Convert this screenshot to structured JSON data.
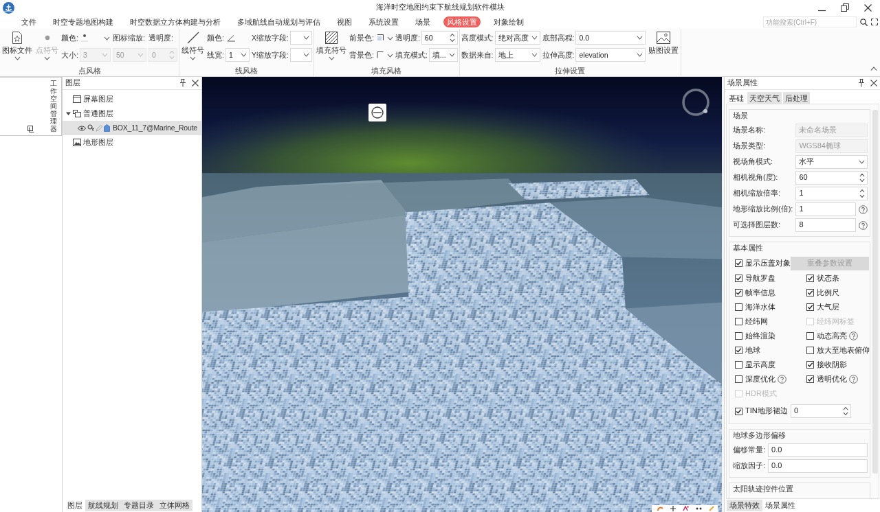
{
  "window": {
    "title": "海洋时空地图约束下航线规划软件模块"
  },
  "menu_tabs": [
    {
      "label": "文件",
      "selected": false
    },
    {
      "label": "时空专题地图构建",
      "selected": false
    },
    {
      "label": "时空数据立方体构建与分析",
      "selected": false
    },
    {
      "label": "多域航线自动规划与评估",
      "selected": false
    },
    {
      "label": "视图",
      "selected": false
    },
    {
      "label": "系统设置",
      "selected": false
    },
    {
      "label": "场景",
      "selected": false
    },
    {
      "label": "风格设置",
      "selected": true
    },
    {
      "label": "对象绘制",
      "selected": false
    }
  ],
  "search": {
    "placeholder": "功能搜索(Ctrl+F)"
  },
  "ribbon_groups": [
    {
      "label": "点风格",
      "items": [
        {
          "kind": "large_button",
          "label": "图标文件",
          "disabled": false,
          "dropdown": true
        },
        {
          "kind": "large_button",
          "label": "点符号",
          "disabled": true,
          "dropdown": true
        },
        {
          "kind": "column",
          "cells": [
            {
              "label": "颜色:",
              "control": {
                "kind": "color",
                "dropdown": true
              }
            },
            {
              "label": "大小:",
              "control": {
                "kind": "combo",
                "value": "3",
                "disabled": true
              }
            }
          ]
        },
        {
          "kind": "column",
          "cells": [
            {
              "label": "图标缩放:"
            },
            {
              "control": {
                "kind": "combo",
                "value": "50",
                "disabled": true
              }
            }
          ]
        },
        {
          "kind": "column",
          "cells": [
            {
              "label": "透明度:"
            },
            {
              "control": {
                "kind": "spin",
                "value": "0",
                "disabled": true
              }
            }
          ]
        }
      ]
    },
    {
      "label": "线风格",
      "items": [
        {
          "kind": "large_button",
          "label": "线符号",
          "disabled": false,
          "dropdown": true
        },
        {
          "kind": "column",
          "cells": [
            {
              "label": "颜色:",
              "control": {
                "kind": "color",
                "dropdown": false
              }
            },
            {
              "label": "线宽:",
              "control": {
                "kind": "combo",
                "value": "1",
                "disabled": false
              }
            }
          ]
        },
        {
          "kind": "column",
          "cells": [
            {
              "label": "X缩放字段:",
              "control": {
                "kind": "combo",
                "disabled": false
              }
            },
            {
              "label": "Y缩放字段:",
              "control": {
                "kind": "combo",
                "disabled": false
              }
            }
          ]
        }
      ]
    },
    {
      "label": "填充风格",
      "items": [
        {
          "kind": "large_button",
          "label": "填充符号",
          "disabled": false,
          "dropdown": true
        },
        {
          "kind": "column",
          "cells": [
            {
              "label": "前景色:",
              "control": {
                "kind": "color",
                "dropdown": true
              }
            },
            {
              "label": "背景色:",
              "control": {
                "kind": "color",
                "dropdown": true
              }
            }
          ]
        },
        {
          "kind": "column",
          "cells": [
            {
              "label": "透明度:",
              "control": {
                "kind": "spin",
                "value": "60",
                "disabled": false
              }
            },
            {
              "label": "填充模式:",
              "control": {
                "kind": "combo",
                "value": "填...",
                "disabled": false
              }
            }
          ]
        }
      ]
    },
    {
      "label": "拉伸设置",
      "items": [
        {
          "kind": "column",
          "cells": [
            {
              "label": "高度模式:",
              "control": {
                "kind": "combo",
                "value": "绝对高度",
                "disabled": false
              }
            },
            {
              "label": "数据来自:",
              "control": {
                "kind": "combo",
                "value": "地上",
                "disabled": false
              }
            }
          ]
        },
        {
          "kind": "column",
          "cells": [
            {
              "label": "底部高程:",
              "control": {
                "kind": "combo",
                "value": "0.0",
                "disabled": false
              }
            },
            {
              "label": "拉伸高度:",
              "control": {
                "kind": "combo",
                "value": "elevation",
                "disabled": false
              }
            }
          ]
        },
        {
          "kind": "large_button",
          "label": "贴图设置",
          "disabled": false,
          "dropdown": false
        }
      ]
    }
  ],
  "workspace_tab": {
    "label": "工作空间管理器"
  },
  "layers_panel": {
    "title": "图层",
    "tree": [
      {
        "kind": "screen",
        "label": "屏幕图层",
        "selected": false
      },
      {
        "kind": "group",
        "label": "普通图层",
        "selected": false,
        "expanded": true,
        "children": [
          {
            "kind": "dataset",
            "label": "BOX_11_7@Marine_Route",
            "selected": true,
            "visible": true,
            "selectable": true,
            "editable": false
          }
        ]
      },
      {
        "kind": "terrain",
        "label": "地形图层",
        "selected": false
      }
    ],
    "tabs": [
      {
        "label": "图层",
        "selected": true
      },
      {
        "label": "航线规划",
        "selected": false
      },
      {
        "label": "专题目录",
        "selected": false
      },
      {
        "label": "立体网格",
        "selected": false
      }
    ]
  },
  "scene_panel": {
    "title": "场景属性",
    "tabs": [
      {
        "label": "基础",
        "selected": true
      },
      {
        "label": "天空天气",
        "selected": false
      },
      {
        "label": "后处理",
        "selected": false
      }
    ],
    "groups": [
      {
        "kind": "form",
        "title": "场景",
        "rows": [
          {
            "label": "场景名称:",
            "kind": "text",
            "value": "未命名场景",
            "disabled": true,
            "help": false
          },
          {
            "label": "场景类型:",
            "kind": "text",
            "value": "WGS84椭球",
            "disabled": true,
            "help": false
          },
          {
            "label": "视场角模式:",
            "kind": "combo",
            "value": "水平",
            "disabled": false,
            "help": false
          },
          {
            "label": "相机视角(度):",
            "kind": "spin",
            "value": "60",
            "disabled": false,
            "help": false
          },
          {
            "label": "相机缩放倍率:",
            "kind": "spin",
            "value": "1",
            "disabled": false,
            "help": false
          },
          {
            "label": "地形缩放比例(倍):",
            "kind": "text",
            "value": "1",
            "disabled": false,
            "help": true
          },
          {
            "label": "可选择图层数:",
            "kind": "text",
            "value": "8",
            "disabled": false,
            "help": true
          }
        ]
      },
      {
        "kind": "options",
        "title": "基本属性",
        "lead": {
          "label": "显示压盖对象",
          "checked": true,
          "disabled": false,
          "button": {
            "label": "重叠参数设置",
            "disabled": true
          }
        },
        "options": [
          {
            "label": "导航罗盘",
            "checked": true,
            "disabled": false,
            "help": false
          },
          {
            "label": "状态条",
            "checked": true,
            "disabled": false,
            "help": false
          },
          {
            "label": "帧率信息",
            "checked": true,
            "disabled": false,
            "help": false
          },
          {
            "label": "比例尺",
            "checked": true,
            "disabled": false,
            "help": false
          },
          {
            "label": "海洋水体",
            "checked": false,
            "disabled": false,
            "help": false
          },
          {
            "label": "大气层",
            "checked": true,
            "disabled": false,
            "help": false
          },
          {
            "label": "经纬网",
            "checked": false,
            "disabled": false,
            "help": false
          },
          {
            "label": "经纬网标签",
            "checked": false,
            "disabled": true,
            "help": false
          },
          {
            "label": "始终渲染",
            "checked": false,
            "disabled": false,
            "help": false
          },
          {
            "label": "动态高亮",
            "checked": false,
            "disabled": false,
            "help": true
          },
          {
            "label": "地球",
            "checked": true,
            "disabled": false,
            "help": false
          },
          {
            "label": "放大至地表俯仰",
            "checked": false,
            "disabled": false,
            "help": false
          },
          {
            "label": "显示高度",
            "checked": false,
            "disabled": false,
            "help": false
          },
          {
            "label": "接收阴影",
            "checked": true,
            "disabled": false,
            "help": false
          },
          {
            "label": "深度优化",
            "checked": false,
            "disabled": false,
            "help": true
          },
          {
            "label": "透明优化",
            "checked": true,
            "disabled": false,
            "help": true
          },
          {
            "label": "HDR模式",
            "checked": false,
            "disabled": true,
            "help": false
          }
        ],
        "tail": {
          "label": "TIN地形裙边",
          "checked": true,
          "disabled": false,
          "field": {
            "kind": "spin",
            "value": "0"
          }
        }
      },
      {
        "kind": "form",
        "title": "地球多边形偏移",
        "rows": [
          {
            "label": "偏移常量:",
            "kind": "text",
            "value": "0.0",
            "disabled": false,
            "help": false
          },
          {
            "label": "缩放因子:",
            "kind": "text",
            "value": "0.0",
            "disabled": false,
            "help": false
          }
        ]
      },
      {
        "kind": "form",
        "title": "太阳轨迹控件位置"
      }
    ],
    "bottom_tabs": [
      {
        "label": "场景特效",
        "selected": false
      },
      {
        "label": "场景属性",
        "selected": true
      }
    ]
  }
}
